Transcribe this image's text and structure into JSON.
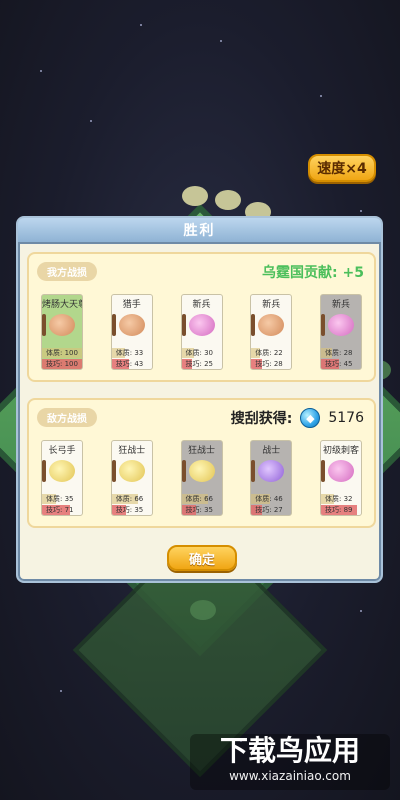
{
  "top_controls": {
    "speed_label": "速度×4"
  },
  "result_modal": {
    "title": "胜利",
    "our_section_label": "我方战损",
    "contribution_text": "乌霆国贡献: +5",
    "our_units": [
      {
        "name": "烤肠大天尊",
        "hp_label": "体质: 100",
        "skill_label": "技巧: 100",
        "hp_pct": 1.0,
        "skill_pct": 1.0,
        "card_style": "green",
        "portrait": "brown",
        "icon": "sword-icon"
      },
      {
        "name": "猎手",
        "hp_label": "体质: 33",
        "skill_label": "技巧: 43",
        "hp_pct": 0.33,
        "skill_pct": 0.43,
        "card_style": "white",
        "portrait": "brown",
        "icon": "bow-icon"
      },
      {
        "name": "新兵",
        "hp_label": "体质: 30",
        "skill_label": "技巧: 25",
        "hp_pct": 0.3,
        "skill_pct": 0.25,
        "card_style": "white",
        "portrait": "pink",
        "icon": "dagger-icon"
      },
      {
        "name": "新兵",
        "hp_label": "体质: 22",
        "skill_label": "技巧: 28",
        "hp_pct": 0.22,
        "skill_pct": 0.28,
        "card_style": "white",
        "portrait": "brown",
        "icon": "dagger-icon"
      },
      {
        "name": "新兵",
        "hp_label": "体质: 28",
        "skill_label": "技巧: 45",
        "hp_pct": 0.28,
        "skill_pct": 0.45,
        "card_style": "gray",
        "portrait": "pink",
        "icon": "blade-icon"
      }
    ],
    "enemy_section_label": "敌方战损",
    "loot_label": "搜刮获得:",
    "loot_value": "5176",
    "enemy_units": [
      {
        "name": "长弓手",
        "hp_label": "体质: 35",
        "skill_label": "技巧: 71",
        "hp_pct": 0.35,
        "skill_pct": 0.71,
        "card_style": "white",
        "portrait": "yellow",
        "icon": "bow-icon"
      },
      {
        "name": "狂战士",
        "hp_label": "体质: 66",
        "skill_label": "技巧: 35",
        "hp_pct": 0.66,
        "skill_pct": 0.35,
        "card_style": "white",
        "portrait": "yellow",
        "icon": "axe-icon"
      },
      {
        "name": "狂战士",
        "hp_label": "体质: 66",
        "skill_label": "技巧: 35",
        "hp_pct": 0.66,
        "skill_pct": 0.35,
        "card_style": "gray",
        "portrait": "yellow",
        "icon": "axe-icon"
      },
      {
        "name": "战士",
        "hp_label": "体质: 46",
        "skill_label": "技巧: 27",
        "hp_pct": 0.46,
        "skill_pct": 0.27,
        "card_style": "gray",
        "portrait": "purple",
        "icon": "shield-icon"
      },
      {
        "name": "初级刺客",
        "hp_label": "体质: 32",
        "skill_label": "技巧: 89",
        "hp_pct": 0.32,
        "skill_pct": 0.89,
        "card_style": "white",
        "portrait": "pink",
        "icon": "dagger-icon"
      }
    ],
    "confirm_label": "确定"
  },
  "watermark": {
    "title": "下载鸟应用",
    "url": "www.xiazainiao.com"
  },
  "colors": {
    "background": "#1b1d2d",
    "modal_bg": "#f6f3e2",
    "panel_bg": "#fff8d6",
    "accent_gold": "#f0a614",
    "contribution_green": "#4bbf5b",
    "skill_red": "#e26b6b"
  }
}
